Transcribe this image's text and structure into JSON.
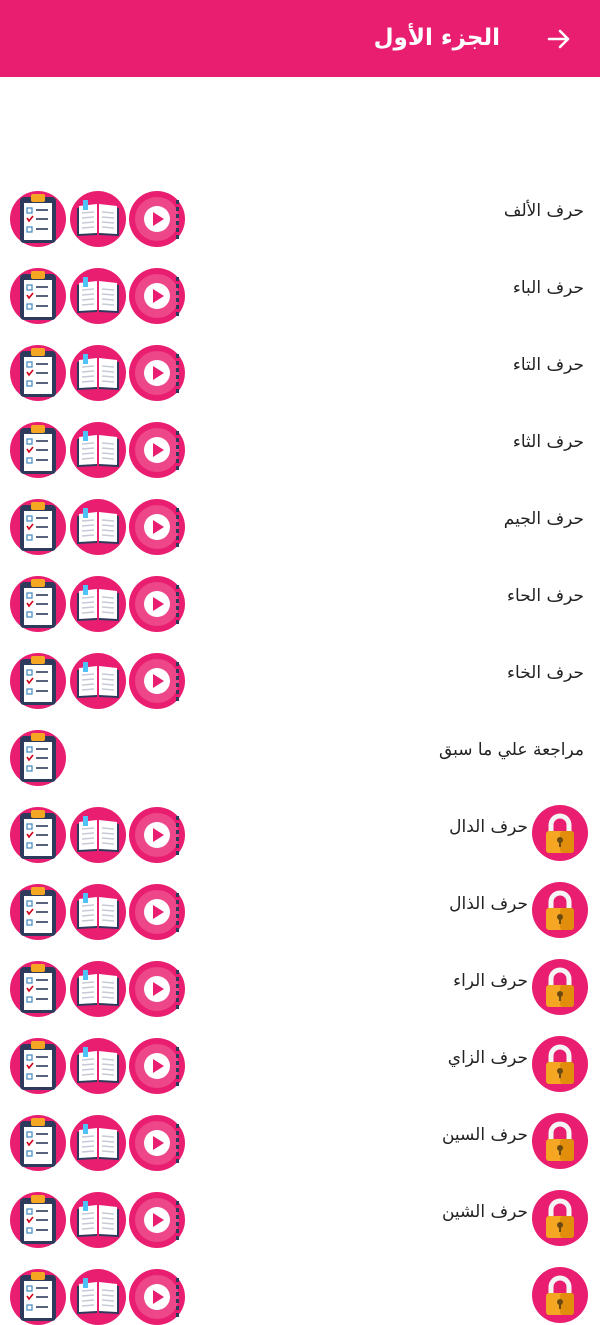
{
  "header": {
    "title": "الجزء الأول",
    "back_icon": "arrow-right-icon",
    "background": "#e91e70"
  },
  "lessons": [
    {
      "label": "حرف الألف",
      "locked": false,
      "actions": [
        "video",
        "book",
        "quiz"
      ]
    },
    {
      "label": "حرف الباء",
      "locked": false,
      "actions": [
        "video",
        "book",
        "quiz"
      ]
    },
    {
      "label": "حرف التاء",
      "locked": false,
      "actions": [
        "video",
        "book",
        "quiz"
      ]
    },
    {
      "label": "حرف الثاء",
      "locked": false,
      "actions": [
        "video",
        "book",
        "quiz"
      ]
    },
    {
      "label": "حرف الجيم",
      "locked": false,
      "actions": [
        "video",
        "book",
        "quiz"
      ]
    },
    {
      "label": "حرف الحاء",
      "locked": false,
      "actions": [
        "video",
        "book",
        "quiz"
      ]
    },
    {
      "label": "حرف الخاء",
      "locked": false,
      "actions": [
        "video",
        "book",
        "quiz"
      ]
    },
    {
      "label": "مراجعة علي ما سبق",
      "locked": false,
      "actions": [
        "quiz"
      ]
    },
    {
      "label": "حرف الدال",
      "locked": true,
      "actions": [
        "video",
        "book",
        "quiz"
      ]
    },
    {
      "label": "حرف الذال",
      "locked": true,
      "actions": [
        "video",
        "book",
        "quiz"
      ]
    },
    {
      "label": "حرف الراء",
      "locked": true,
      "actions": [
        "video",
        "book",
        "quiz"
      ]
    },
    {
      "label": "حرف الزاي",
      "locked": true,
      "actions": [
        "video",
        "book",
        "quiz"
      ]
    },
    {
      "label": "حرف السين",
      "locked": true,
      "actions": [
        "video",
        "book",
        "quiz"
      ]
    },
    {
      "label": "حرف الشين",
      "locked": true,
      "actions": [
        "video",
        "book",
        "quiz"
      ]
    },
    {
      "label": "",
      "locked": true,
      "actions": [
        "video",
        "book",
        "quiz"
      ]
    }
  ],
  "icons": {
    "video": "play-video-icon",
    "book": "open-book-icon",
    "quiz": "clipboard-checklist-icon",
    "lock": "padlock-icon"
  },
  "colors": {
    "accent": "#e91e70",
    "lock_body": "#f5a623",
    "icon_dark": "#2e3a5c"
  }
}
